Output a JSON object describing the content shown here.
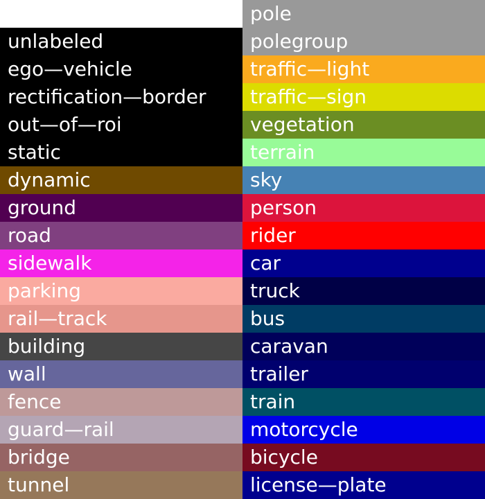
{
  "legend": {
    "left": [
      {
        "label": "unlabeled",
        "color": "#000000"
      },
      {
        "label": "ego—vehicle",
        "color": "#000000"
      },
      {
        "label": "rectification—border",
        "color": "#000000"
      },
      {
        "label": "out—of—roi",
        "color": "#000000"
      },
      {
        "label": "static",
        "color": "#000000"
      },
      {
        "label": "dynamic",
        "color": "#6f4a00"
      },
      {
        "label": "ground",
        "color": "#510051"
      },
      {
        "label": "road",
        "color": "#804080"
      },
      {
        "label": "sidewalk",
        "color": "#f423e8"
      },
      {
        "label": "parking",
        "color": "#faaaa0"
      },
      {
        "label": "rail—track",
        "color": "#e6968c"
      },
      {
        "label": "building",
        "color": "#464646"
      },
      {
        "label": "wall",
        "color": "#66669c"
      },
      {
        "label": "fence",
        "color": "#be9999"
      },
      {
        "label": "guard—rail",
        "color": "#b4a5b4"
      },
      {
        "label": "bridge",
        "color": "#966464"
      },
      {
        "label": "tunnel",
        "color": "#96785a"
      }
    ],
    "right": [
      {
        "label": "pole",
        "color": "#999999"
      },
      {
        "label": "polegroup",
        "color": "#999999"
      },
      {
        "label": "traffic—light",
        "color": "#faaa1e"
      },
      {
        "label": "traffic—sign",
        "color": "#dcdc00"
      },
      {
        "label": "vegetation",
        "color": "#6b8e23"
      },
      {
        "label": "terrain",
        "color": "#98fb98"
      },
      {
        "label": "sky",
        "color": "#4682b4"
      },
      {
        "label": "person",
        "color": "#dc143c"
      },
      {
        "label": "rider",
        "color": "#ff0000"
      },
      {
        "label": "car",
        "color": "#00008e"
      },
      {
        "label": "truck",
        "color": "#000046"
      },
      {
        "label": "bus",
        "color": "#003c64"
      },
      {
        "label": "caravan",
        "color": "#00005a"
      },
      {
        "label": "trailer",
        "color": "#00006e"
      },
      {
        "label": "train",
        "color": "#005064"
      },
      {
        "label": "motorcycle",
        "color": "#0000e6"
      },
      {
        "label": "bicycle",
        "color": "#770b20"
      },
      {
        "label": "license—plate",
        "color": "#00008e"
      }
    ]
  }
}
